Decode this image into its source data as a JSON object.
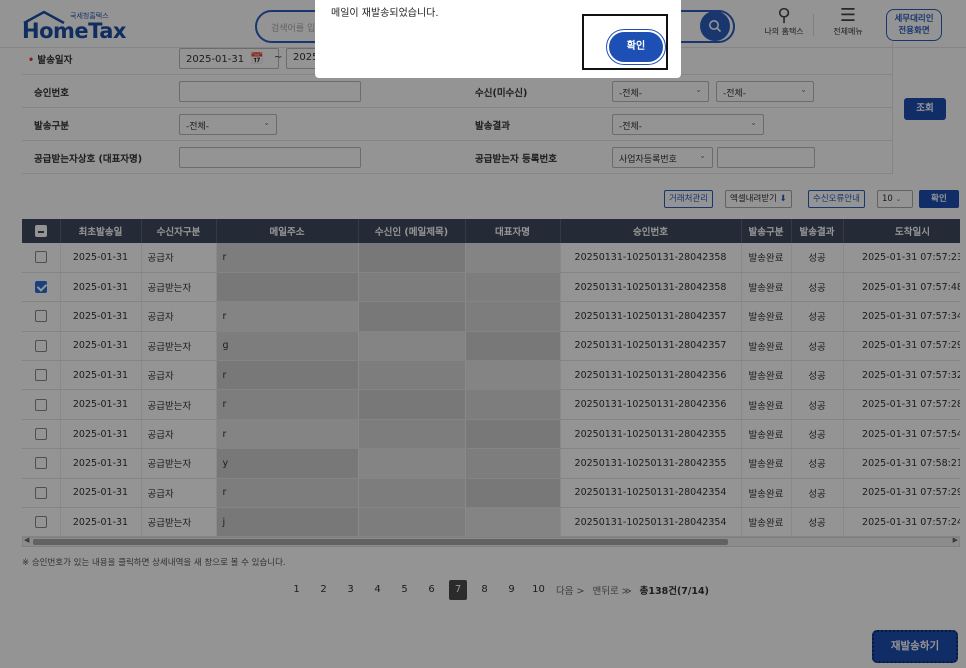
{
  "header": {
    "logo_sub": "국세청홈택스",
    "logo_main": "HomeTax",
    "search_placeholder": "검색어를 입",
    "my_hometax": "나의 홈택스",
    "all_menu": "전체메뉴",
    "tax_agent": "세무대리인\n전용화면"
  },
  "form": {
    "send_date_label": "발송일자",
    "date_from": "2025-01-31",
    "date_sep": "~",
    "date_to": "2025",
    "approval_label": "승인번호",
    "recipient_label": "수신(미수신)",
    "recipient_sel1": "-전체-",
    "recipient_sel2": "-전체-",
    "send_type_label": "발송구분",
    "send_type_sel": "-전체-",
    "send_result_label": "발송결과",
    "send_result_sel": "-전체-",
    "supplier_label": "공급받는자상호 (대표자명)",
    "supplier_reg_label": "공급받는자 등록번호",
    "supplier_reg_sel": "사업자등록번호",
    "search_button": "조회"
  },
  "toolbar": {
    "partner_mgmt": "거래처관리",
    "excel_download": "엑셀내려받기",
    "recv_error_info": "수신오류안내",
    "page_size": "10",
    "confirm": "확인"
  },
  "table": {
    "headers": [
      "",
      "최초발송일",
      "수신자구분",
      "메일주소",
      "수신인 (메일제목)",
      "대표자명",
      "승인번호",
      "발송구분",
      "발송결과",
      "도착일시"
    ],
    "rows": [
      {
        "checked": false,
        "date": "2025-01-31",
        "type": "공급자",
        "email": "r",
        "approval": "20250131-10250131-28042358",
        "send": "발송완료",
        "result": "성공",
        "arrival": "2025-01-31 07:57:23"
      },
      {
        "checked": true,
        "date": "2025-01-31",
        "type": "공급받는자",
        "email": "",
        "approval": "20250131-10250131-28042358",
        "send": "발송완료",
        "result": "성공",
        "arrival": "2025-01-31 07:57:48"
      },
      {
        "checked": false,
        "date": "2025-01-31",
        "type": "공급자",
        "email": "r",
        "approval": "20250131-10250131-28042357",
        "send": "발송완료",
        "result": "성공",
        "arrival": "2025-01-31 07:57:34"
      },
      {
        "checked": false,
        "date": "2025-01-31",
        "type": "공급받는자",
        "email": "g",
        "approval": "20250131-10250131-28042357",
        "send": "발송완료",
        "result": "성공",
        "arrival": "2025-01-31 07:57:29"
      },
      {
        "checked": false,
        "date": "2025-01-31",
        "type": "공급자",
        "email": "r",
        "approval": "20250131-10250131-28042356",
        "send": "발송완료",
        "result": "성공",
        "arrival": "2025-01-31 07:57:32"
      },
      {
        "checked": false,
        "date": "2025-01-31",
        "type": "공급받는자",
        "email": "r",
        "approval": "20250131-10250131-28042356",
        "send": "발송완료",
        "result": "성공",
        "arrival": "2025-01-31 07:57:28"
      },
      {
        "checked": false,
        "date": "2025-01-31",
        "type": "공급자",
        "email": "r",
        "approval": "20250131-10250131-28042355",
        "send": "발송완료",
        "result": "성공",
        "arrival": "2025-01-31 07:57:54"
      },
      {
        "checked": false,
        "date": "2025-01-31",
        "type": "공급받는자",
        "email": "y",
        "approval": "20250131-10250131-28042355",
        "send": "발송완료",
        "result": "성공",
        "arrival": "2025-01-31 07:58:21"
      },
      {
        "checked": false,
        "date": "2025-01-31",
        "type": "공급자",
        "email": "r",
        "approval": "20250131-10250131-28042354",
        "send": "발송완료",
        "result": "성공",
        "arrival": "2025-01-31 07:57:29"
      },
      {
        "checked": false,
        "date": "2025-01-31",
        "type": "공급받는자",
        "email": "j",
        "approval": "20250131-10250131-28042354",
        "send": "발송완료",
        "result": "성공",
        "arrival": "2025-01-31 07:57:24"
      }
    ]
  },
  "note": "※ 승인번호가 있는 내용을 클릭하면 상세내역을 새 창으로 볼 수 있습니다.",
  "pagination": {
    "pages": [
      "1",
      "2",
      "3",
      "4",
      "5",
      "6",
      "7",
      "8",
      "9",
      "10"
    ],
    "current": "7",
    "next": "다음 >",
    "last": "맨뒤로 ≫",
    "total": "총138건(7/14)"
  },
  "resend_button": "재발송하기",
  "modal": {
    "message": "메일이 재발송되었습니다.",
    "confirm": "확인"
  }
}
